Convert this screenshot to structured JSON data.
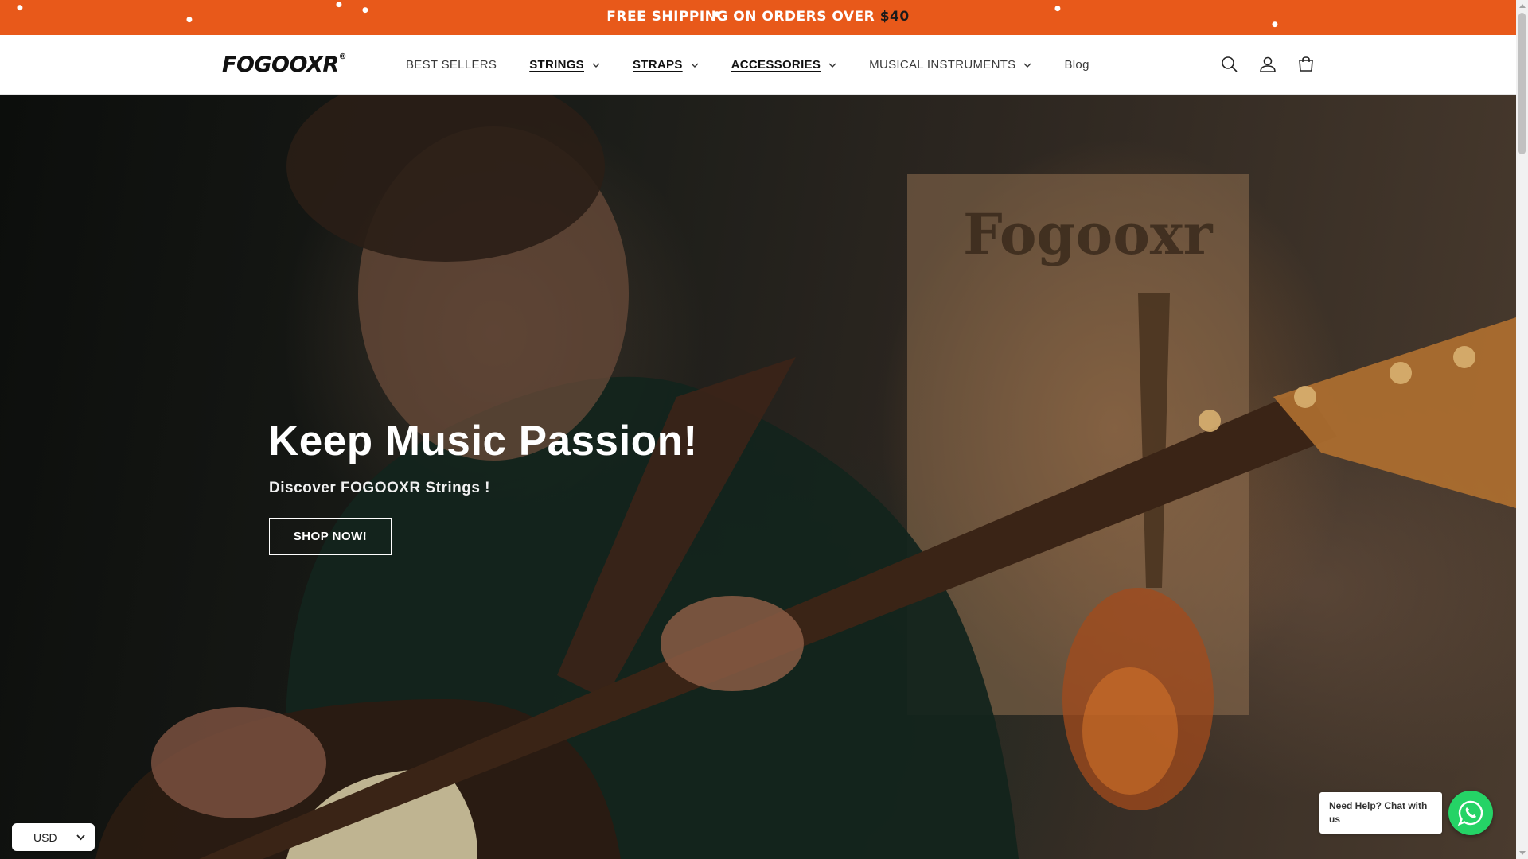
{
  "announcement": {
    "text": "FREE SHIPPING ON ORDERS OVER ",
    "price": "$40"
  },
  "header": {
    "logo": "FOGOOXR",
    "logo_mark": "®",
    "nav": [
      {
        "label": "BEST SELLERS",
        "dropdown": false
      },
      {
        "label": "STRINGS",
        "dropdown": true
      },
      {
        "label": "STRAPS",
        "dropdown": true
      },
      {
        "label": "ACCESSORIES",
        "dropdown": true
      },
      {
        "label": "MUSICAL INSTRUMENTS",
        "dropdown": true
      },
      {
        "label": "Blog",
        "dropdown": false
      }
    ],
    "icons": [
      "search-icon",
      "account-icon",
      "cart-icon"
    ]
  },
  "hero": {
    "title": "Keep Music Passion!",
    "subtitle": "Discover FOGOOXR Strings !",
    "button": "SHOP NOW!",
    "poster_text": "Fogooxr"
  },
  "currency": {
    "selected": "USD"
  },
  "chat": {
    "bubble": "Need Help? Chat with us"
  },
  "colors": {
    "announcement_bg": "#e8591a",
    "whatsapp_green": "#25d366"
  }
}
